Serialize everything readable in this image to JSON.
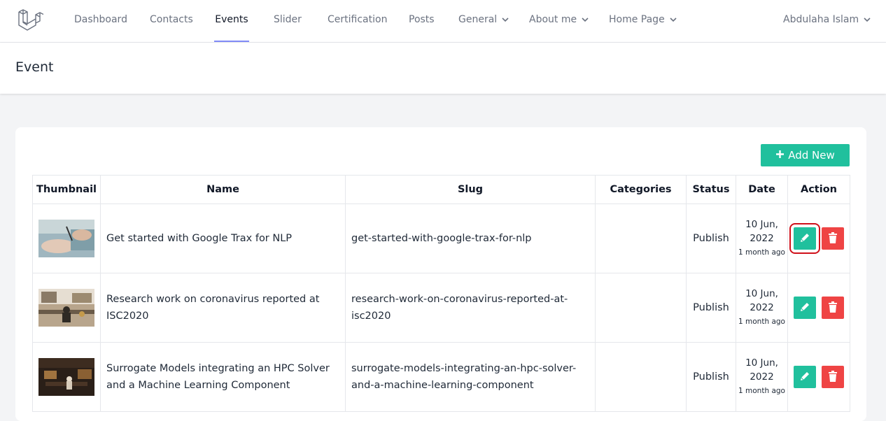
{
  "nav": {
    "items": [
      {
        "label": "Dashboard"
      },
      {
        "label": "Contacts"
      },
      {
        "label": "Events"
      },
      {
        "label": "Slider"
      },
      {
        "label": "Certification"
      },
      {
        "label": "Posts"
      },
      {
        "label": "General"
      },
      {
        "label": "About me"
      },
      {
        "label": "Home Page"
      }
    ],
    "active": "Events",
    "user": "Abdulaha Islam"
  },
  "page": {
    "title": "Event"
  },
  "add_button": {
    "label": "Add New",
    "icon": "plus-icon"
  },
  "table": {
    "headers": [
      "Thumbnail",
      "Name",
      "Slug",
      "Categories",
      "Status",
      "Date",
      "Action"
    ],
    "rows": [
      {
        "name": "Get started with Google Trax for NLP",
        "slug": "get-started-with-google-trax-for-nlp",
        "categories": "",
        "status": "Publish",
        "date": "10 Jun, 2022",
        "relative": "1 month ago"
      },
      {
        "name": "Research work on coronavirus reported at ISC2020",
        "slug": "research-work-on-coronavirus-reported-at-isc2020",
        "categories": "",
        "status": "Publish",
        "date": "10 Jun, 2022",
        "relative": "1 month ago"
      },
      {
        "name": "Surrogate Models integrating an HPC Solver and a Machine Learning Component",
        "slug": "surrogate-models-integrating-an-hpc-solver-and-a-machine-learning-component",
        "categories": "",
        "status": "Publish",
        "date": "10 Jun, 2022",
        "relative": "1 month ago"
      }
    ]
  },
  "colors": {
    "accent": "#20c09d",
    "danger": "#ef4444",
    "active_underline": "#818cf8",
    "highlight": "#d0101a"
  }
}
